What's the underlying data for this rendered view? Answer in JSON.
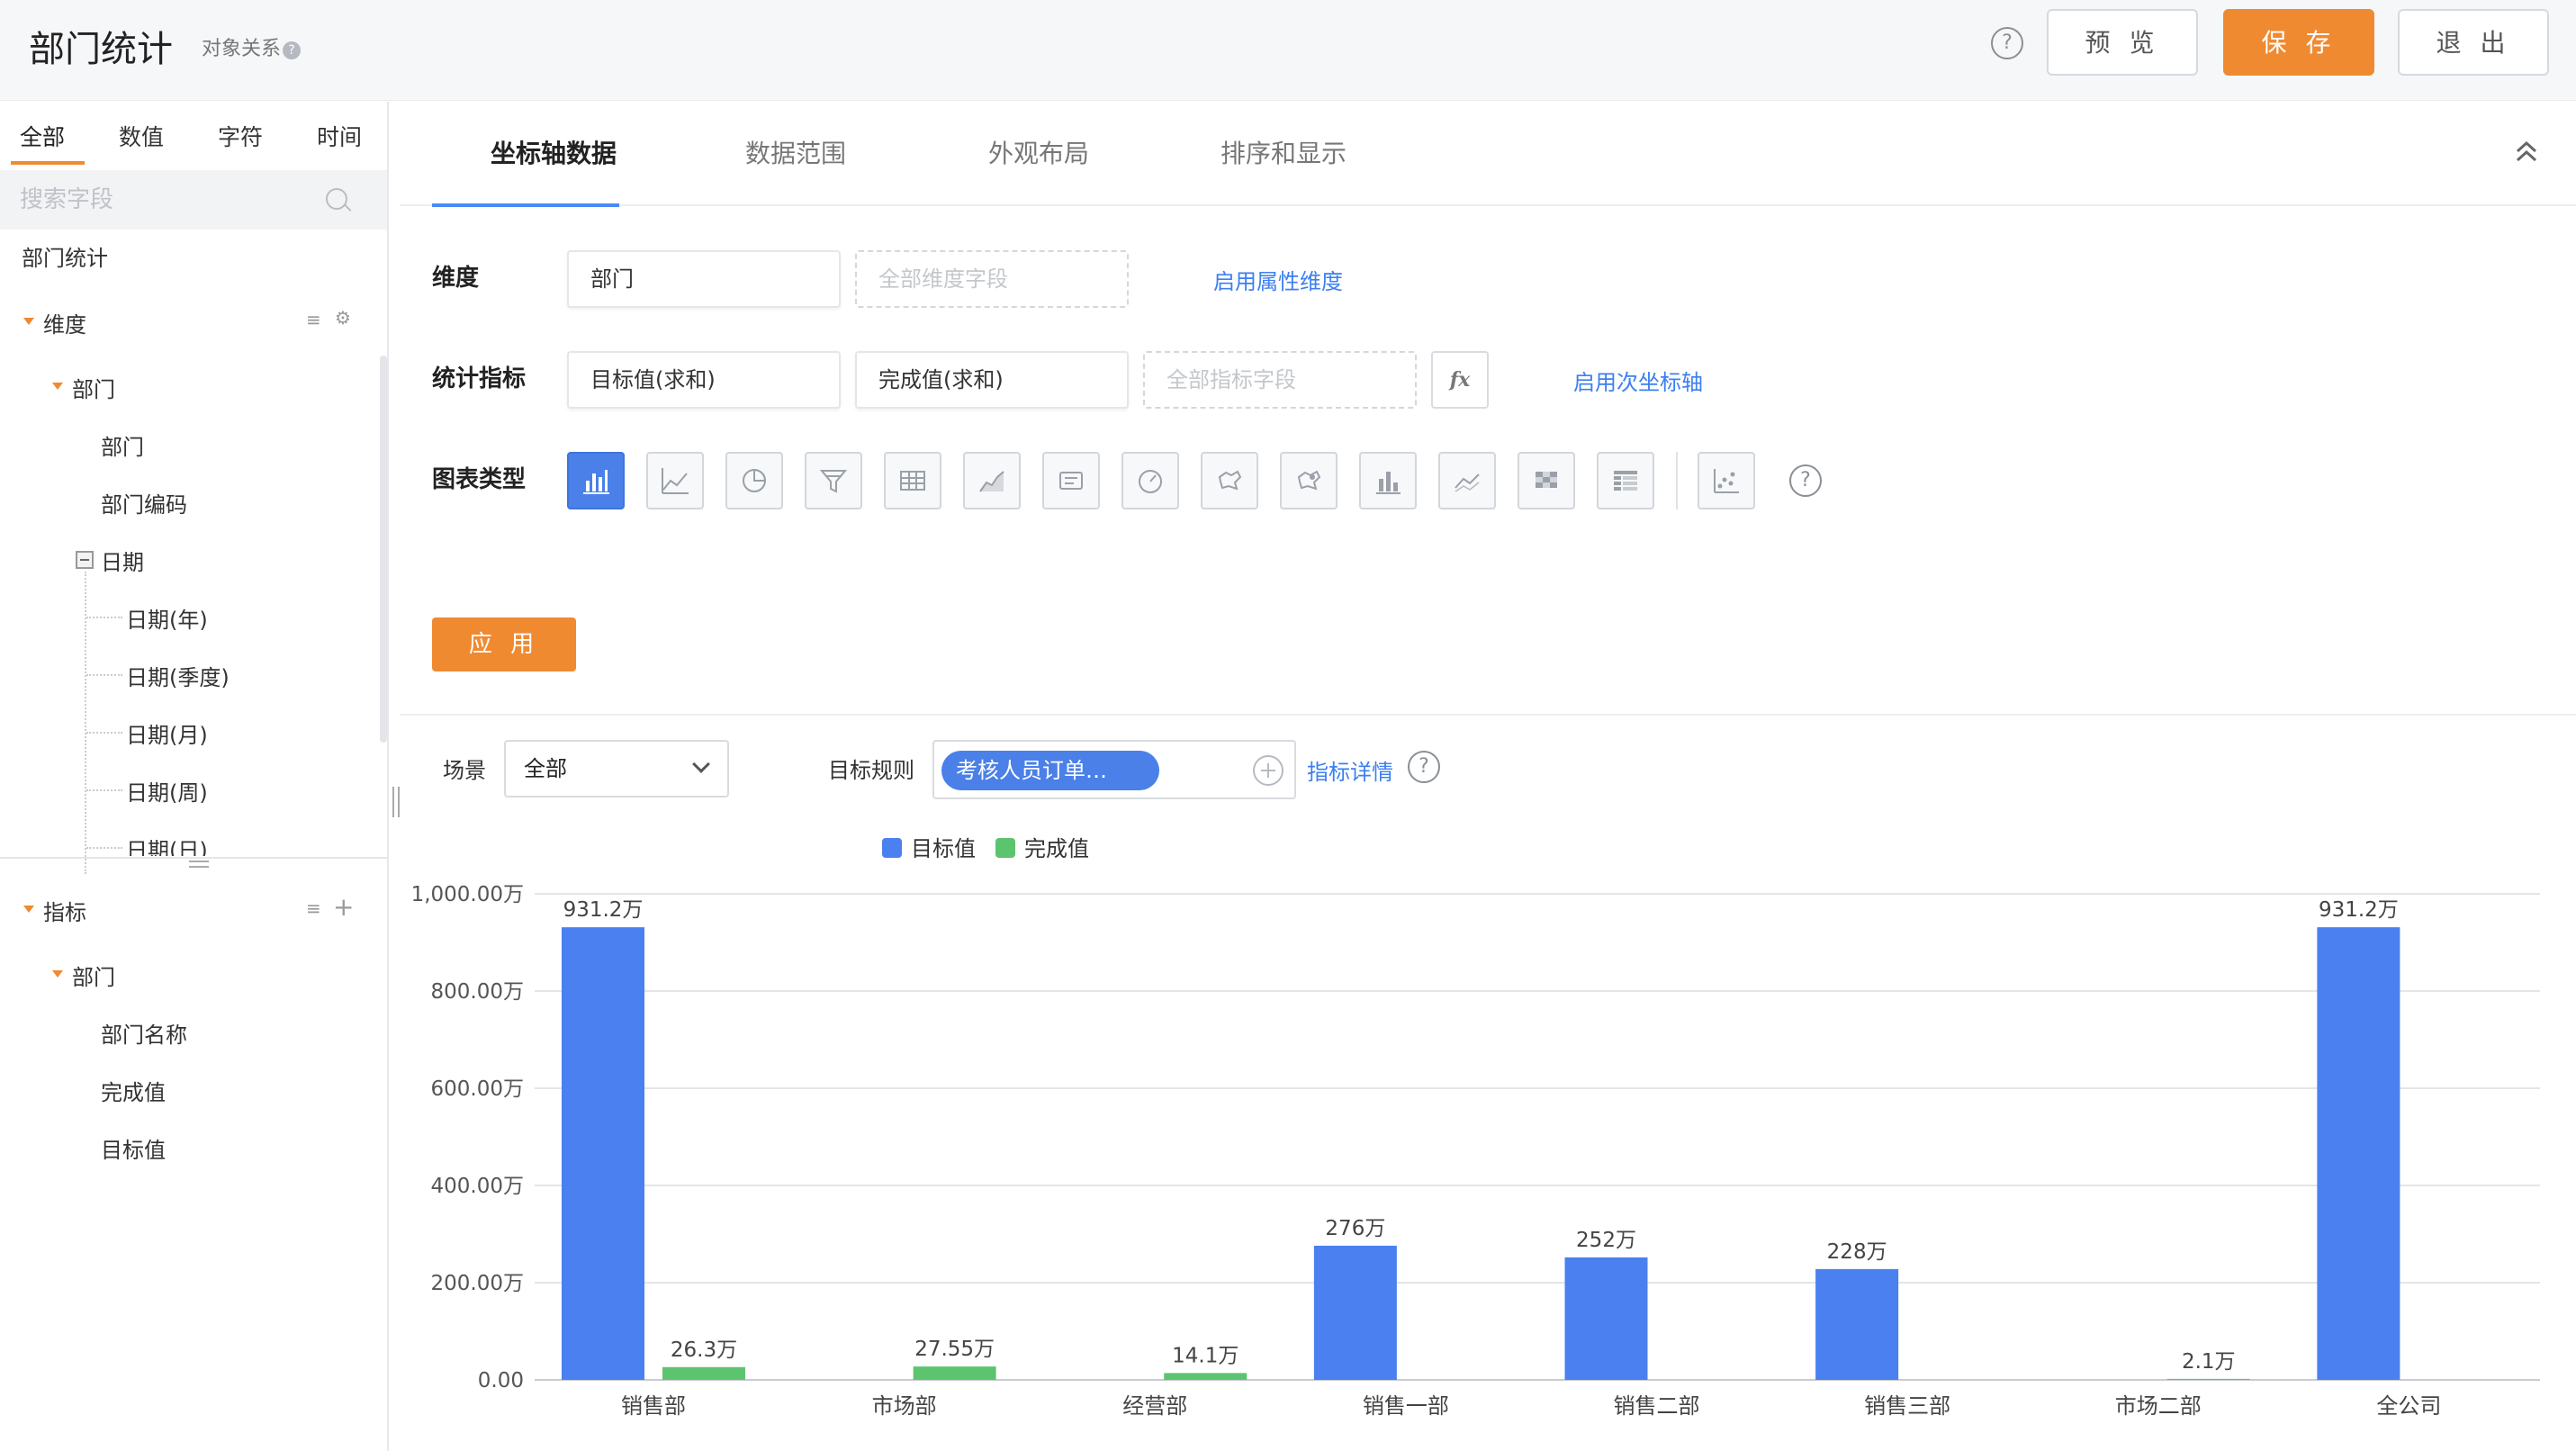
{
  "header": {
    "title": "部门统计",
    "object_relation": "对象关系",
    "help_icon": "question-circle-icon",
    "preview_label": "预 览",
    "save_label": "保 存",
    "exit_label": "退 出",
    "accent_color": "#f08a31"
  },
  "left_panel": {
    "tabs": [
      {
        "label": "全部",
        "active": true
      },
      {
        "label": "数值",
        "active": false
      },
      {
        "label": "字符",
        "active": false
      },
      {
        "label": "时间",
        "active": false
      }
    ],
    "search": {
      "placeholder": "搜索字段",
      "value": ""
    },
    "root": "部门统计",
    "dimension_section": {
      "label": "维度",
      "group": "部门",
      "fields": [
        "部门",
        "部门编码"
      ],
      "date_group": "日期",
      "date_fields": [
        "日期(年)",
        "日期(季度)",
        "日期(月)",
        "日期(周)",
        "日期(日)"
      ]
    },
    "metric_section": {
      "label": "指标",
      "group": "部门",
      "fields": [
        "部门名称",
        "完成值",
        "目标值"
      ]
    }
  },
  "config": {
    "tabs": [
      "坐标轴数据",
      "数据范围",
      "外观布局",
      "排序和显示"
    ],
    "active_tab": "坐标轴数据",
    "dimension_label": "维度",
    "dimension_value": "部门",
    "dimension_placeholder": "全部维度字段",
    "enable_attr_dim": "启用属性维度",
    "metric_label": "统计指标",
    "metrics": [
      "目标值(求和)",
      "完成值(求和)"
    ],
    "metric_placeholder": "全部指标字段",
    "fx_label": "fx",
    "enable_secondary_axis": "启用次坐标轴",
    "chart_type_label": "图表类型",
    "chart_types": [
      "bar-chart-icon",
      "line-chart-icon",
      "pie-chart-icon",
      "funnel-chart-icon",
      "table-chart-icon",
      "area-chart-icon",
      "text-card-icon",
      "gauge-chart-icon",
      "map-chart-icon",
      "point-map-icon",
      "stacked-bar-icon",
      "combo-line-icon",
      "heatmap-icon",
      "cross-table-icon",
      "scatter-chart-icon"
    ],
    "selected_chart_type": "bar-chart-icon",
    "apply_label": "应 用"
  },
  "filters": {
    "scene_label": "场景",
    "scene_value": "全部",
    "rule_label": "目标规则",
    "rule_tag": "考核人员订单…",
    "detail_link": "指标详情"
  },
  "chart_data": {
    "type": "bar",
    "categories": [
      "销售部",
      "市场部",
      "经营部",
      "销售一部",
      "销售二部",
      "销售三部",
      "市场二部",
      "全公司"
    ],
    "series": [
      {
        "name": "目标值",
        "color": "#4a80f0",
        "values": [
          931.2,
          null,
          null,
          276,
          252,
          228,
          null,
          931.2
        ],
        "labels": [
          "931.2万",
          "",
          "",
          "276万",
          "252万",
          "228万",
          "",
          "931.2万"
        ]
      },
      {
        "name": "完成值",
        "color": "#5cc46e",
        "values": [
          26.3,
          27.55,
          null,
          null,
          null,
          null,
          2.1,
          null
        ],
        "labels": [
          "26.3万",
          "27.55万",
          "",
          "",
          "",
          "",
          "2.1万",
          ""
        ]
      }
    ],
    "extra_labels": [
      {
        "category": "经营部",
        "series": "完成值",
        "value": 14.1,
        "label": "14.1万"
      }
    ],
    "y_ticks": [
      "0.00",
      "200.00万",
      "400.00万",
      "600.00万",
      "800.00万",
      "1,000.00万"
    ],
    "ylim": [
      0,
      1000
    ],
    "grid": true,
    "legend": "top-center",
    "unit": "万"
  }
}
